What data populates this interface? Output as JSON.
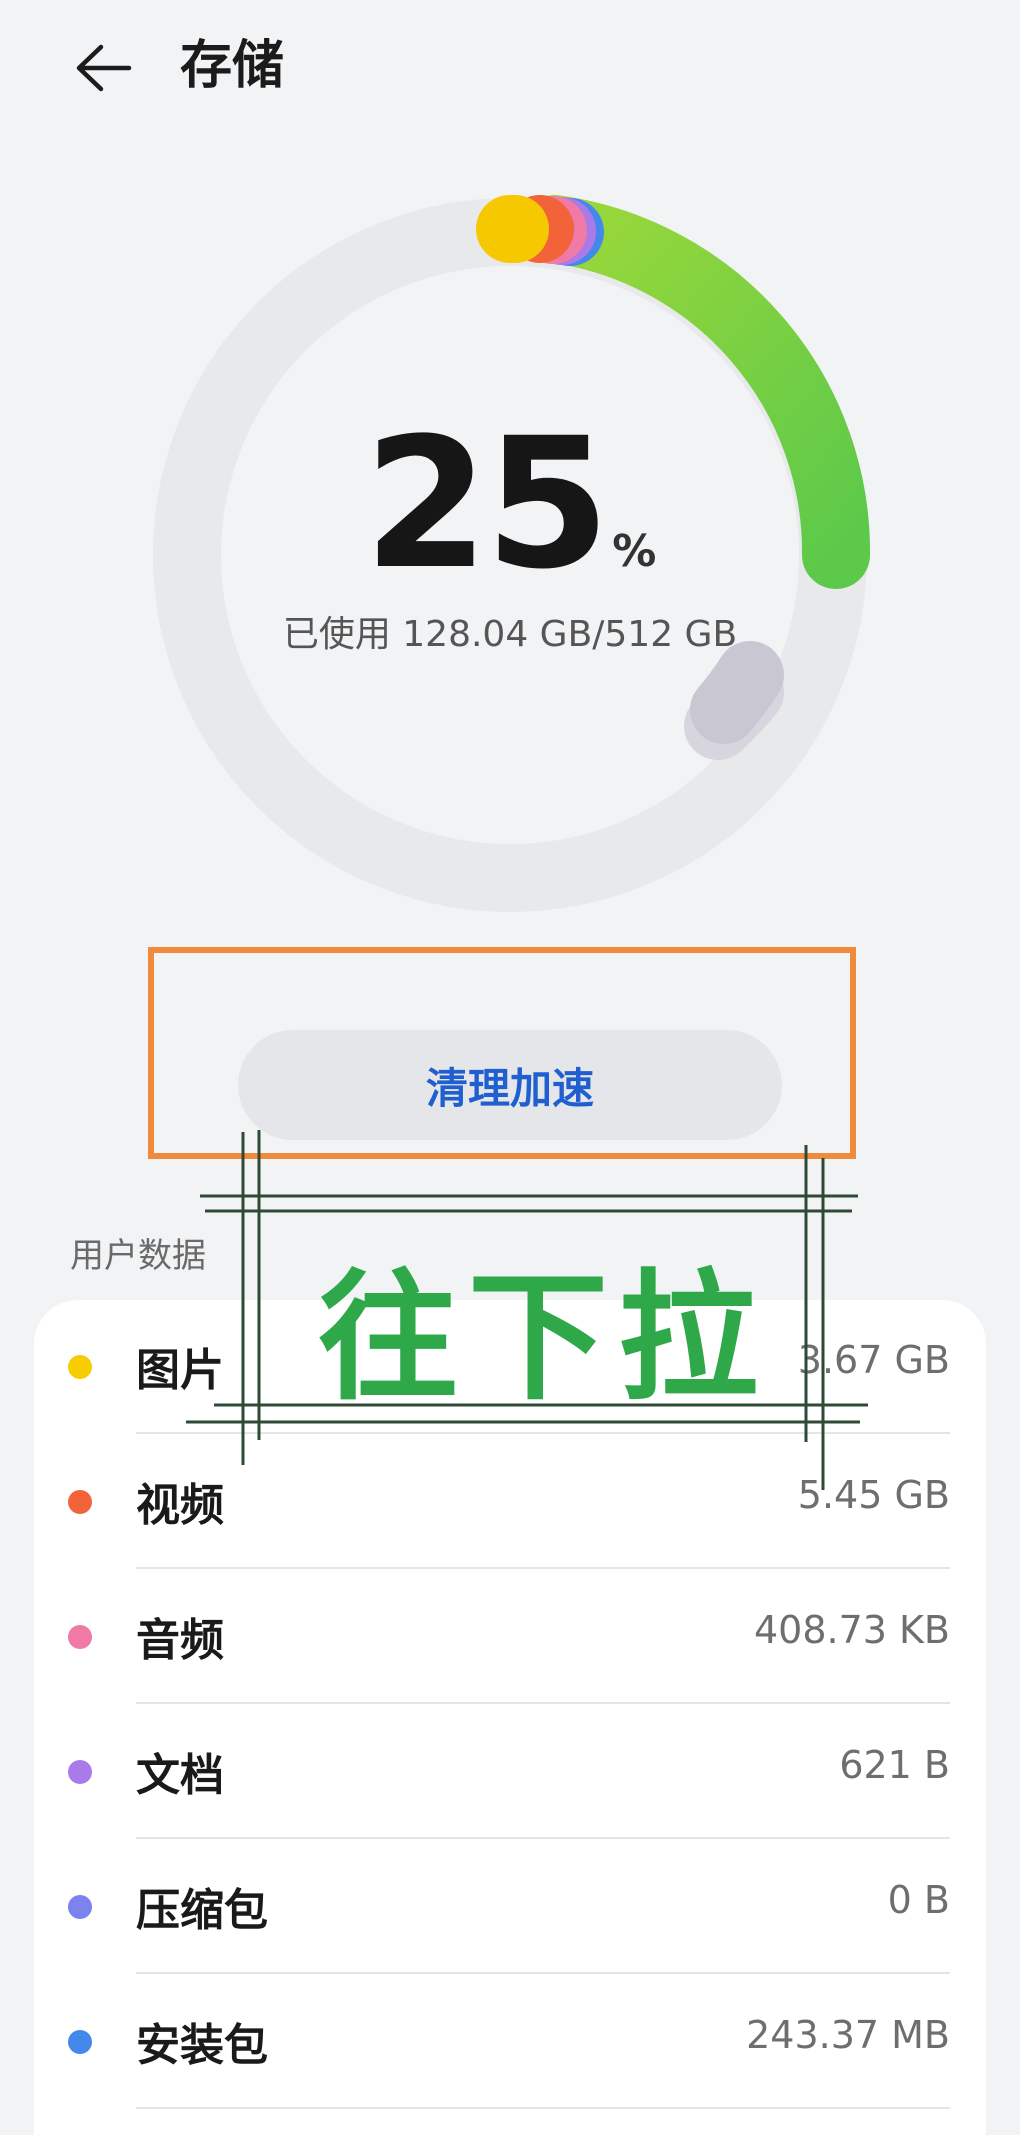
{
  "header": {
    "title": "存储"
  },
  "storage": {
    "percent_value": "25",
    "percent_sign": "%",
    "usage_text": "已使用 128.04 GB/512 GB",
    "used_fraction": 0.25
  },
  "action": {
    "clean_label": "清理加速"
  },
  "overlay": {
    "text": "往下拉",
    "highlight_color": "#f08a3c",
    "text_color": "#2fa84a"
  },
  "user_data": {
    "section_label": "用户数据",
    "items": [
      {
        "label": "图片",
        "value": "3.67 GB",
        "color": "#f7cc00"
      },
      {
        "label": "视频",
        "value": "5.45 GB",
        "color": "#f2633a"
      },
      {
        "label": "音频",
        "value": "408.73 KB",
        "color": "#f07aa6"
      },
      {
        "label": "文档",
        "value": "621 B",
        "color": "#a97ae8"
      },
      {
        "label": "压缩包",
        "value": "0 B",
        "color": "#7c82ee"
      },
      {
        "label": "安装包",
        "value": "243.37 MB",
        "color": "#4488ec"
      }
    ]
  },
  "colors": {
    "accent_blue": "#1f5fcf",
    "green_segment": "#7dd63a",
    "system_segment": "#c9c7d1"
  }
}
